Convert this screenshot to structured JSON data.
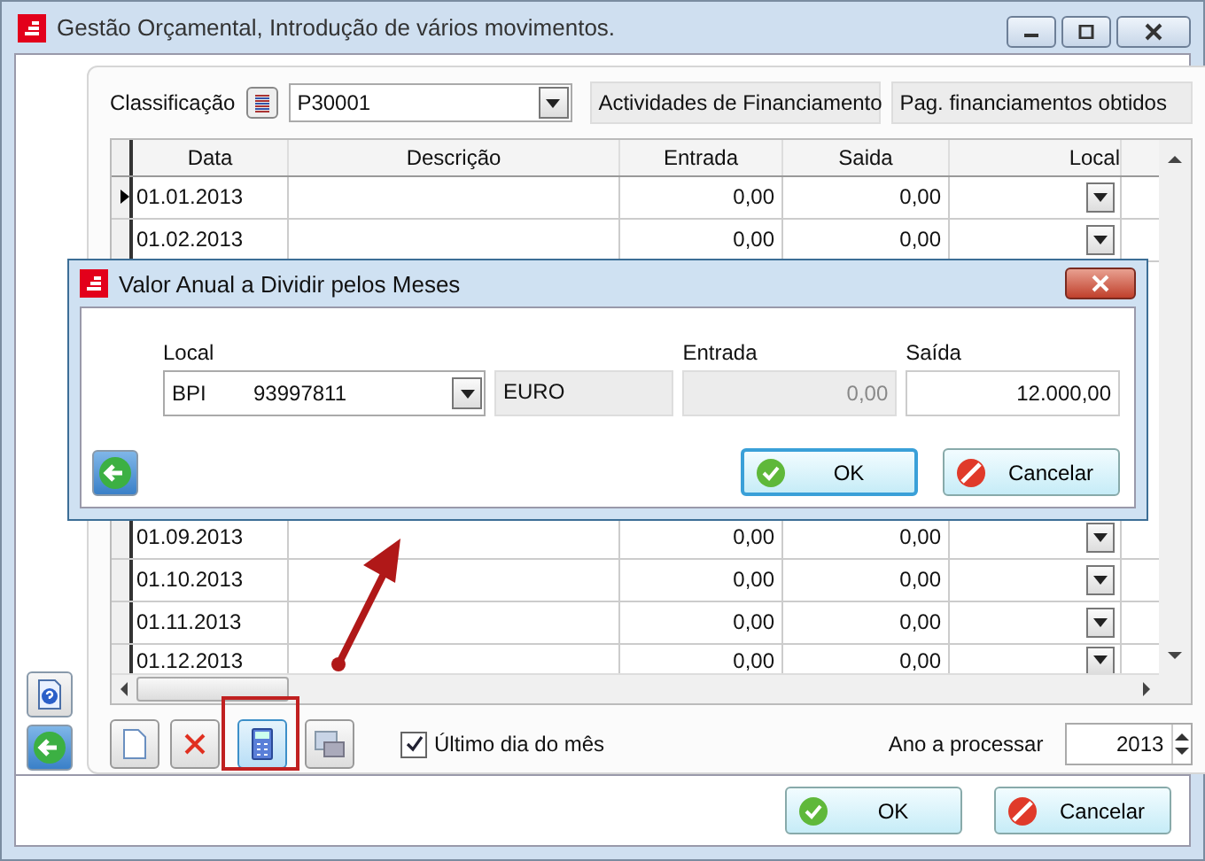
{
  "window": {
    "title": "Gestão Orçamental, Introdução de vários movimentos."
  },
  "classification": {
    "label": "Classificação",
    "value": "P30001",
    "group": "Actividades de Financiamento",
    "subgroup": "Pag. financiamentos obtidos"
  },
  "grid": {
    "columns": [
      "Data",
      "Descrição",
      "Entrada",
      "Saida",
      "Local"
    ],
    "rows_top": [
      {
        "date": "01.01.2013",
        "entrada": "0,00",
        "saida": "0,00",
        "current": true
      },
      {
        "date": "01.02.2013",
        "entrada": "0,00",
        "saida": "0,00",
        "current": false
      }
    ],
    "rows_bottom": [
      {
        "date": "01.09.2013",
        "entrada": "0,00",
        "saida": "0,00",
        "current": false
      },
      {
        "date": "01.10.2013",
        "entrada": "0,00",
        "saida": "0,00",
        "current": false
      },
      {
        "date": "01.11.2013",
        "entrada": "0,00",
        "saida": "0,00",
        "current": false
      },
      {
        "date": "01.12.2013",
        "entrada": "0,00",
        "saida": "0,00",
        "current": false
      }
    ]
  },
  "toolbar": {
    "last_day": {
      "label": "Último dia do mês",
      "checked": true
    },
    "year_label": "Ano a processar",
    "year": "2013"
  },
  "buttons": {
    "ok": "OK",
    "cancel": "Cancelar"
  },
  "dialog": {
    "title": "Valor Anual a Dividir pelos Meses",
    "local_label": "Local",
    "local_bank": "BPI",
    "local_account": "93997811",
    "currency": "EURO",
    "entrada_label": "Entrada",
    "entrada": "0,00",
    "saida_label": "Saída",
    "saida": "12.000,00",
    "ok": "OK",
    "cancel": "Cancelar"
  }
}
